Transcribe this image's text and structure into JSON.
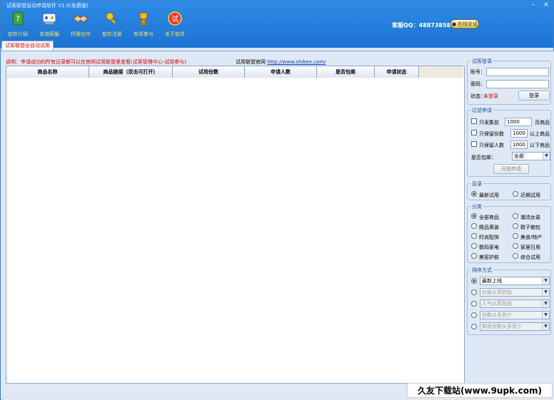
{
  "window": {
    "title": "试客联盟自动申请软件 V1.0(免费版)"
  },
  "toolbar": [
    {
      "name": "software-intro",
      "label": "软件介绍",
      "icon": "help-book-icon"
    },
    {
      "name": "consult-service",
      "label": "咨询客服",
      "icon": "chat-icon"
    },
    {
      "name": "agent-cooperation",
      "label": "代理合作",
      "icon": "handshake-icon"
    },
    {
      "name": "software-register",
      "label": "软件注册",
      "icon": "key-icon"
    },
    {
      "name": "trophy",
      "label": "有奖参与",
      "icon": "trophy-icon"
    },
    {
      "name": "about",
      "label": "关于软件",
      "icon": "about-badge-icon",
      "glyph": "试"
    }
  ],
  "header": {
    "qq_text": "客服QQ：488738580",
    "qq_button": "在线交谈"
  },
  "tab": {
    "label": "试客联盟全自动试用"
  },
  "main": {
    "note": "说明：申请成功的所有记录都可以在官网试用联盟里查看(试客管理中心-试用参与)",
    "site_label": "试用联盟官网",
    "site_url": "http://www.shikee.com/",
    "columns": [
      "商品名称",
      "商品链接（双击可打开）",
      "试用份数",
      "申请人数",
      "是否包邮",
      "申请状态"
    ]
  },
  "login": {
    "title": "试客登录",
    "account_label": "账号：",
    "password_label": "密码：",
    "status_label": "状态：",
    "status_value": "未登录",
    "login_button": "登录"
  },
  "filter": {
    "title": "过滤申请",
    "rows": [
      {
        "prefix": "只采集前",
        "value": "1000",
        "suffix": "页商品"
      },
      {
        "prefix": "只保留份数",
        "value": "1000",
        "suffix": "以上商品"
      },
      {
        "prefix": "只保留人数",
        "value": "1000",
        "suffix": "以下商品"
      }
    ],
    "shipping_label": "是否包邮：",
    "shipping_value": "全部",
    "start_button": "开始申请"
  },
  "catalog": {
    "title": "目录",
    "options": [
      "最新试用",
      "近期试用"
    ]
  },
  "category": {
    "title": "分类",
    "options": [
      "全部商品",
      "潮流女装",
      "精品男装",
      "鞋子箱包",
      "时尚配饰",
      "美食/特产",
      "数码家电",
      "家居日用",
      "美容护肤",
      "综合试用"
    ]
  },
  "sort": {
    "title": "排序方式",
    "options": [
      "最新上线",
      "价格从高到低",
      "人气从高到低",
      "份数从多到少",
      "剩余份数从多到少"
    ]
  },
  "watermark": {
    "text": "久友下载站(www.9upk.com)"
  }
}
